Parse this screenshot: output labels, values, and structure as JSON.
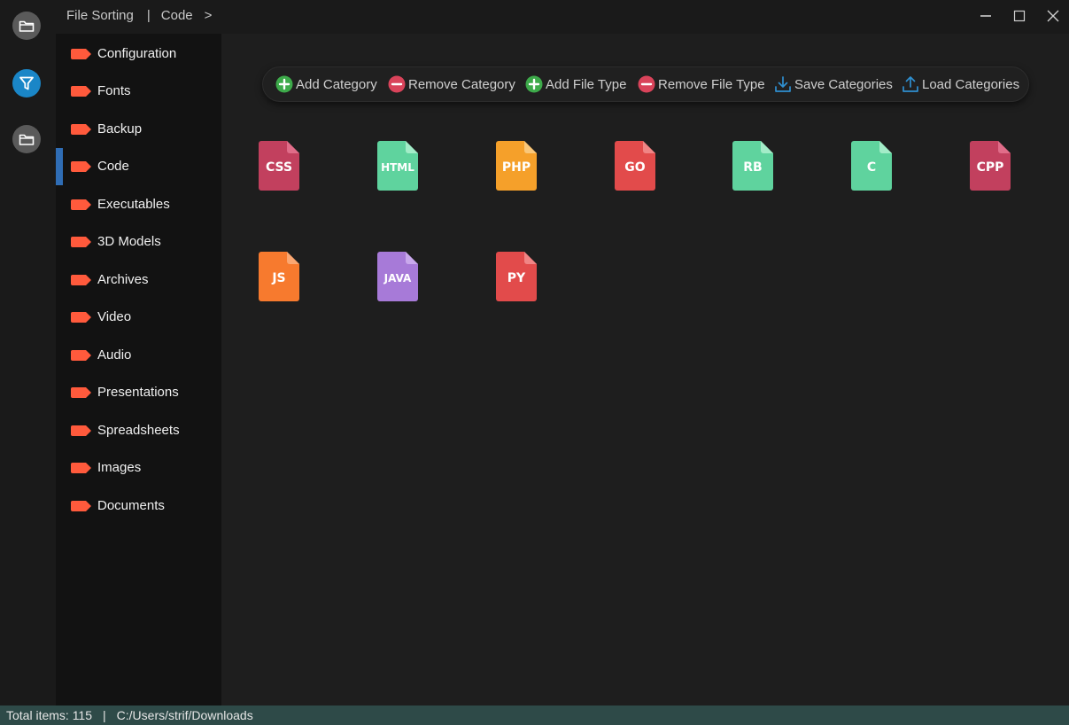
{
  "titlebar": {
    "breadcrumb": [
      "File Sorting",
      "|",
      "Code",
      ">"
    ],
    "window_controls": [
      "minimize-icon",
      "maximize-icon",
      "close-icon"
    ]
  },
  "rail": {
    "buttons": [
      {
        "icon": "folder-icon",
        "color": "#5a5a5a"
      },
      {
        "icon": "filter-icon",
        "color": "#1a86c7"
      },
      {
        "icon": "folder-icon",
        "color": "#5a5a5a"
      }
    ]
  },
  "sidebar": {
    "tag_color": "#ff5a3c",
    "active_color": "#2f6db5",
    "items": [
      {
        "label": "Configuration"
      },
      {
        "label": "Fonts"
      },
      {
        "label": "Backup"
      },
      {
        "label": "Code",
        "active": true
      },
      {
        "label": "Executables"
      },
      {
        "label": "3D Models"
      },
      {
        "label": "Archives"
      },
      {
        "label": "Video"
      },
      {
        "label": "Audio"
      },
      {
        "label": "Presentations"
      },
      {
        "label": "Spreadsheets"
      },
      {
        "label": "Images"
      },
      {
        "label": "Documents"
      }
    ]
  },
  "toolbar": {
    "buttons": [
      {
        "label": "Add Category",
        "icon": "plus-circle-icon",
        "color": "#3daa4a"
      },
      {
        "label": "Remove Category",
        "icon": "minus-circle-icon",
        "color": "#d9435a"
      },
      {
        "label": "Add File Type",
        "icon": "plus-circle-icon",
        "color": "#3daa4a"
      },
      {
        "label": "Remove File Type",
        "icon": "minus-circle-icon",
        "color": "#d9435a"
      },
      {
        "label": "Save Categories",
        "icon": "download-icon",
        "color": "#2f8fd0"
      },
      {
        "label": "Load Categories",
        "icon": "upload-icon",
        "color": "#2f8fd0"
      }
    ]
  },
  "file_types": [
    {
      "ext": "CSS",
      "color": "#c2405e",
      "fold": "#e06d89"
    },
    {
      "ext": "HTML",
      "color": "#5fd39e",
      "fold": "#a3ecc8"
    },
    {
      "ext": "PHP",
      "color": "#f5a02a",
      "fold": "#f9c77a"
    },
    {
      "ext": "GO",
      "color": "#e24b4b",
      "fold": "#f08585"
    },
    {
      "ext": "RB",
      "color": "#5fd39e",
      "fold": "#a3ecc8"
    },
    {
      "ext": "C",
      "color": "#5fd39e",
      "fold": "#a3ecc8"
    },
    {
      "ext": "CPP",
      "color": "#c2405e",
      "fold": "#e06d89"
    },
    {
      "ext": "JS",
      "color": "#f77a2e",
      "fold": "#faa772"
    },
    {
      "ext": "JAVA",
      "color": "#a77ad8",
      "fold": "#c9a9ec"
    },
    {
      "ext": "PY",
      "color": "#e24b4b",
      "fold": "#f08585"
    }
  ],
  "statusbar": {
    "total_label": "Total items: 115",
    "separator": "|",
    "path": "C:/Users/strif/Downloads",
    "color": "#2e4a48"
  }
}
